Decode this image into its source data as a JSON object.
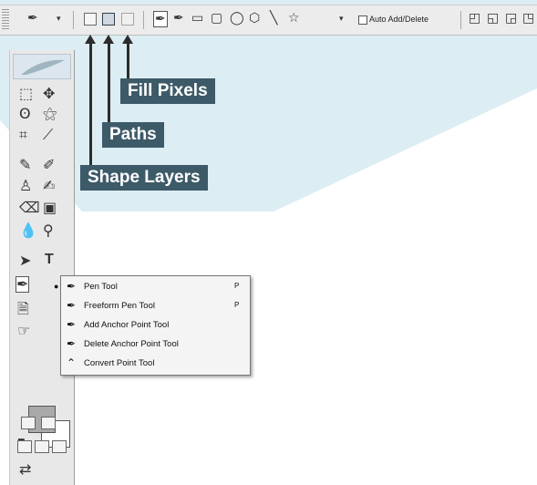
{
  "options_bar": {
    "auto_add_delete_label": "Auto Add/Delete"
  },
  "callouts": {
    "fill_pixels": "Fill Pixels",
    "paths": "Paths",
    "shape_layers": "Shape Layers"
  },
  "flyout": {
    "items": [
      {
        "label": "Pen Tool",
        "shortcut": "P",
        "icon": "pen-icon",
        "selected": true
      },
      {
        "label": "Freeform Pen Tool",
        "shortcut": "P",
        "icon": "freeform-pen-icon",
        "selected": false
      },
      {
        "label": "Add Anchor Point Tool",
        "shortcut": "",
        "icon": "add-anchor-point-icon",
        "selected": false
      },
      {
        "label": "Delete Anchor Point Tool",
        "shortcut": "",
        "icon": "delete-anchor-point-icon",
        "selected": false
      },
      {
        "label": "Convert Point Tool",
        "shortcut": "",
        "icon": "convert-point-icon",
        "selected": false
      }
    ]
  },
  "tools_text": {
    "type_tool": "T"
  },
  "colors": {
    "callout_bg": "#3d5a68",
    "backdrop": "#dcedf3"
  }
}
